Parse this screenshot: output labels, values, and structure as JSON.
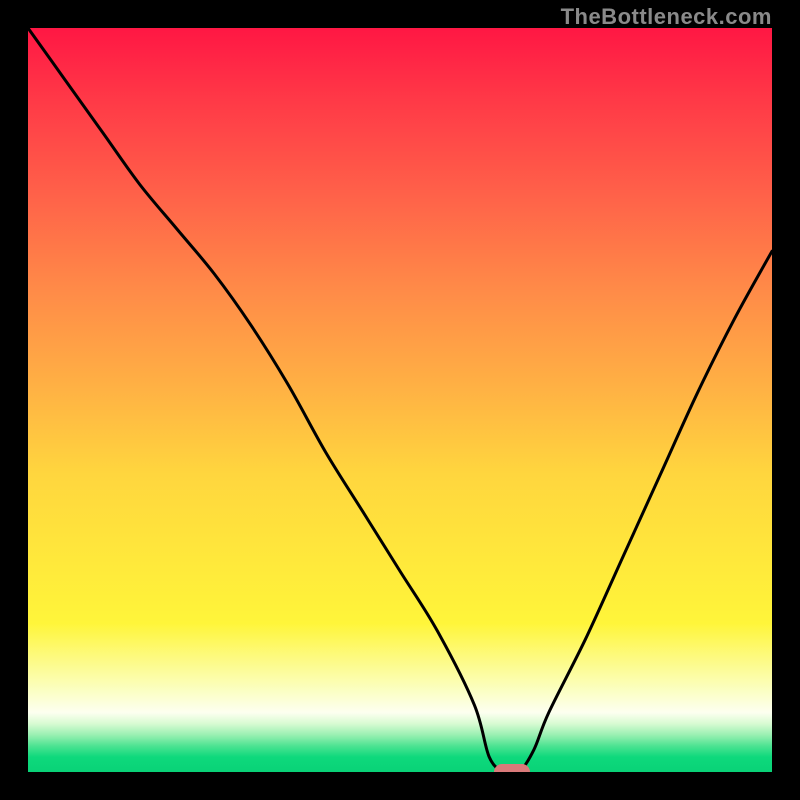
{
  "watermark": "TheBottleneck.com",
  "chart_data": {
    "type": "line",
    "title": "",
    "xlabel": "",
    "ylabel": "",
    "ylim": [
      0,
      100
    ],
    "x": [
      0,
      5,
      10,
      15,
      20,
      25,
      30,
      35,
      40,
      45,
      50,
      55,
      60,
      62,
      64,
      66,
      68,
      70,
      75,
      80,
      85,
      90,
      95,
      100
    ],
    "values": [
      100,
      93,
      86,
      79,
      73,
      67,
      60,
      52,
      43,
      35,
      27,
      19,
      9,
      2,
      0,
      0,
      3,
      8,
      18,
      29,
      40,
      51,
      61,
      70
    ],
    "marker": {
      "x": 65,
      "y": 0
    },
    "gradient_stops": [
      {
        "pos": 0,
        "color": "#ff1744"
      },
      {
        "pos": 50,
        "color": "#ffb044"
      },
      {
        "pos": 80,
        "color": "#fff53a"
      },
      {
        "pos": 100,
        "color": "#09d277"
      }
    ]
  }
}
